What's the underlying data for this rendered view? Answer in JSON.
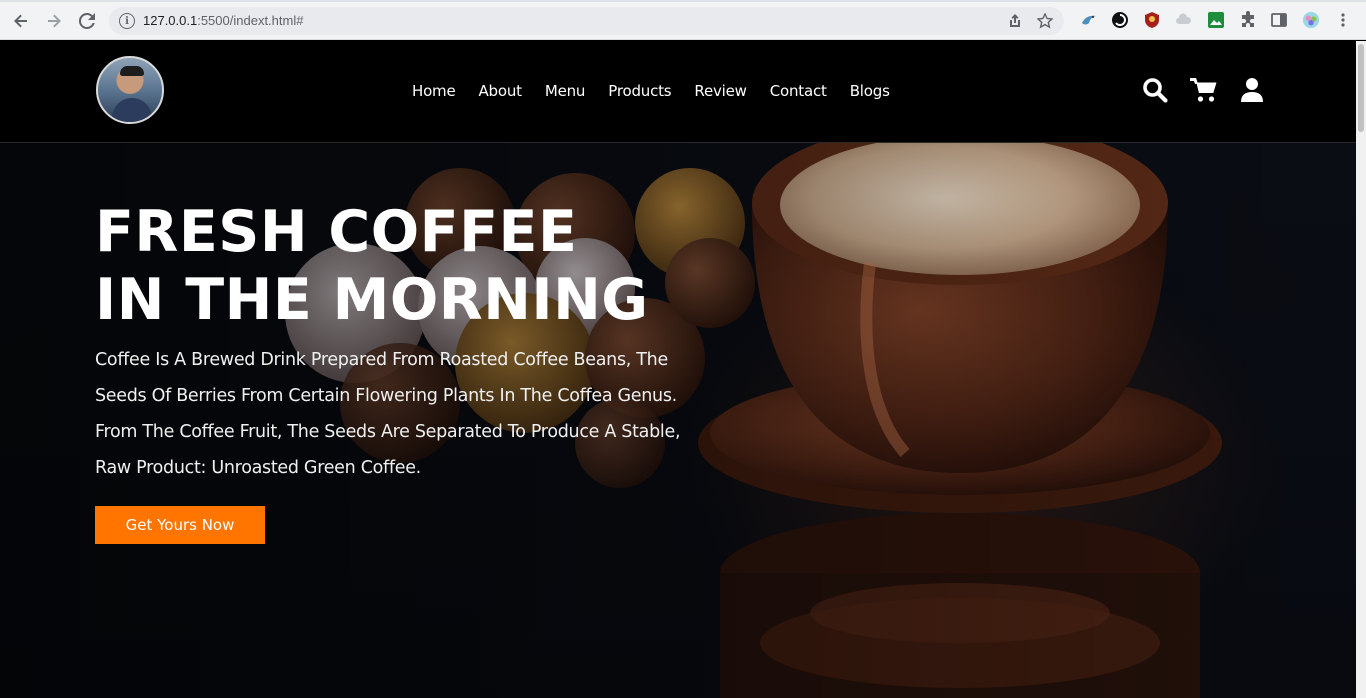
{
  "browser": {
    "url_host": "127.0.0.1",
    "url_path": ":5500/indext.html#"
  },
  "nav": {
    "items": [
      "Home",
      "About",
      "Menu",
      "Products",
      "Review",
      "Contact",
      "Blogs"
    ]
  },
  "header_icons": [
    "search-icon",
    "cart-icon",
    "user-icon"
  ],
  "hero": {
    "title": "FRESH COFFEE IN THE MORNING",
    "description": "Coffee Is A Brewed Drink Prepared From Roasted Coffee Beans, The Seeds Of Berries From Certain Flowering Plants In The Coffea Genus. From The Coffee Fruit, The Seeds Are Separated To Produce A Stable, Raw Product: Unroasted Green Coffee.",
    "cta_label": "Get Yours Now"
  },
  "colors": {
    "accent": "#ff7500",
    "header_bg": "#000000"
  }
}
